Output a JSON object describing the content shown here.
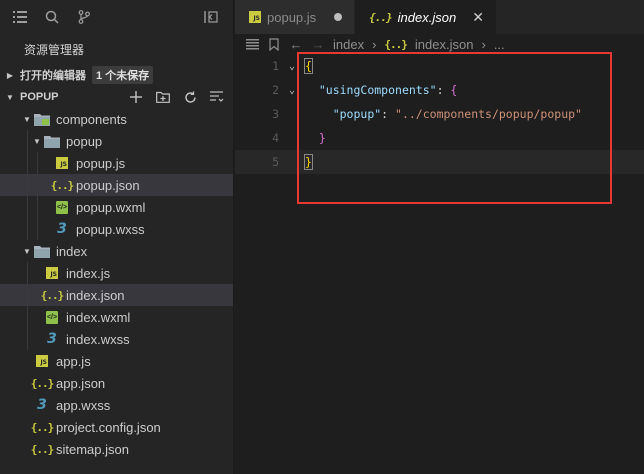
{
  "sidebar": {
    "explorer_title": "资源管理器",
    "open_editors": {
      "label": "打开的编辑器",
      "badge": "1 个未保存"
    },
    "project": {
      "label": "POPUP"
    },
    "tree": [
      {
        "name": "components",
        "icon": "folder-components-icon",
        "indent": 1,
        "arrow": "▼"
      },
      {
        "name": "popup",
        "icon": "folder-icon",
        "indent": 2,
        "arrow": "▼"
      },
      {
        "name": "popup.js",
        "icon": "js-file-icon",
        "indent": 3
      },
      {
        "name": "popup.json",
        "icon": "json-file-icon",
        "indent": 3,
        "selected": true
      },
      {
        "name": "popup.wxml",
        "icon": "wxml-file-icon",
        "indent": 3
      },
      {
        "name": "popup.wxss",
        "icon": "css-file-icon",
        "indent": 3
      },
      {
        "name": "index",
        "icon": "folder-icon",
        "indent": 1,
        "arrow": "▼"
      },
      {
        "name": "index.js",
        "icon": "js-file-icon",
        "indent": 2
      },
      {
        "name": "index.json",
        "icon": "json-file-icon",
        "indent": 2,
        "selected": true
      },
      {
        "name": "index.wxml",
        "icon": "wxml-file-icon",
        "indent": 2
      },
      {
        "name": "index.wxss",
        "icon": "css-file-icon",
        "indent": 2
      },
      {
        "name": "app.js",
        "icon": "js-file-icon",
        "indent": 1
      },
      {
        "name": "app.json",
        "icon": "json-file-icon",
        "indent": 1
      },
      {
        "name": "app.wxss",
        "icon": "css-file-icon",
        "indent": 1
      },
      {
        "name": "project.config.json",
        "icon": "json-file-icon",
        "indent": 1
      },
      {
        "name": "sitemap.json",
        "icon": "json-file-icon",
        "indent": 1
      }
    ]
  },
  "tabs": [
    {
      "label": "popup.js",
      "icon": "js-file-icon",
      "unsaved": true
    },
    {
      "label": "index.json",
      "icon": "json-file-icon",
      "active": true
    }
  ],
  "breadcrumb": {
    "folder": "index",
    "file": "index.json",
    "more": "..."
  },
  "code": {
    "line_numbers": [
      "1",
      "2",
      "3",
      "4",
      "5"
    ],
    "open_brace": "{",
    "using_key": "\"usingComponents\"",
    "colon": ": ",
    "inner_open": "{",
    "popup_key": "\"popup\"",
    "popup_value": "\"../components/popup/popup\"",
    "inner_close": "}",
    "close_brace": "}"
  },
  "colors": {
    "highlight_box": "#e53935",
    "json_icon": "#cbcb41",
    "selected_row": "#37373d"
  }
}
